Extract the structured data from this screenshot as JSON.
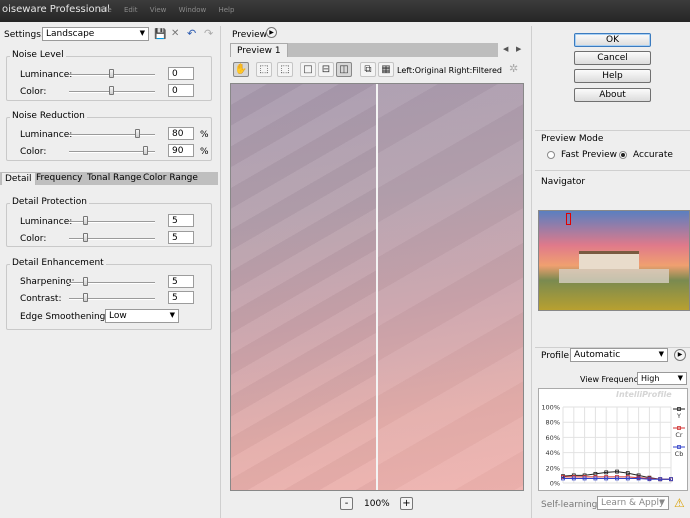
{
  "window": {
    "title": "oiseware Professional",
    "menus": [
      "File",
      "Edit",
      "View",
      "Window",
      "Help"
    ]
  },
  "settings": {
    "label": "Settings:",
    "value": "Landscape"
  },
  "noise_level": {
    "title": "Noise Level",
    "luminance": {
      "label": "Luminance:",
      "value": "0",
      "level": 0.5
    },
    "color": {
      "label": "Color:",
      "value": "0",
      "level": 0.5
    }
  },
  "noise_reduction": {
    "title": "Noise Reduction",
    "luminance": {
      "label": "Luminance:",
      "value": "80",
      "unit": "%",
      "level": 0.8
    },
    "color": {
      "label": "Color:",
      "value": "90",
      "unit": "%",
      "level": 0.9
    }
  },
  "tabs": [
    "Detail",
    "Frequency",
    "Tonal Range",
    "Color Range"
  ],
  "detail_protection": {
    "title": "Detail Protection",
    "luminance": {
      "label": "Luminance:",
      "value": "5",
      "level": 0.2
    },
    "color": {
      "label": "Color:",
      "value": "5",
      "level": 0.2
    }
  },
  "detail_enhancement": {
    "title": "Detail Enhancement",
    "sharpening": {
      "label": "Sharpening:",
      "value": "5",
      "level": 0.2
    },
    "contrast": {
      "label": "Contrast:",
      "value": "5",
      "level": 0.2
    },
    "edge_smoothing": {
      "label": "Edge Smoothening:",
      "value": "Low"
    }
  },
  "preview": {
    "title": "Preview",
    "tab": "Preview 1",
    "split_label": "Left:Original Right:Filtered",
    "zoom": "100%",
    "zoom_out": "-",
    "zoom_in": "+"
  },
  "buttons": {
    "ok": "OK",
    "cancel": "Cancel",
    "help": "Help",
    "about": "About"
  },
  "preview_mode": {
    "title": "Preview Mode",
    "fast": "Fast Preview",
    "accurate": "Accurate",
    "selected": "accurate"
  },
  "navigator": {
    "title": "Navigator"
  },
  "profile": {
    "label": "Profile:",
    "value": "Automatic",
    "view_frequency_label": "View Frequency:",
    "view_frequency_value": "High",
    "watermark": "IntelliProfile",
    "y_ticks": [
      "100%",
      "80%",
      "60%",
      "40%",
      "20%",
      "0%"
    ],
    "legend": [
      "Y",
      "Cr",
      "Cb"
    ],
    "self_learning_label": "Self-learning:",
    "self_learning_value": "Learn & Apply"
  },
  "colors": {
    "y_series": "#222222",
    "cr_series": "#d03030",
    "cb_series": "#3040c8",
    "accent": "#3b7bbf"
  },
  "chart_data": {
    "type": "line",
    "ylim": [
      0,
      100
    ],
    "yticks": [
      "100%",
      "80%",
      "60%",
      "40%",
      "20%",
      "0%"
    ],
    "series": [
      {
        "name": "Y",
        "values": [
          9,
          10,
          10,
          12,
          14,
          15,
          13,
          10,
          7,
          5,
          5
        ]
      },
      {
        "name": "Cr",
        "values": [
          8,
          8,
          8,
          8,
          8,
          8,
          8,
          7,
          6,
          5,
          5
        ]
      },
      {
        "name": "Cb",
        "values": [
          6,
          6,
          6,
          6,
          6,
          6,
          6,
          6,
          5,
          5,
          5
        ]
      }
    ]
  }
}
